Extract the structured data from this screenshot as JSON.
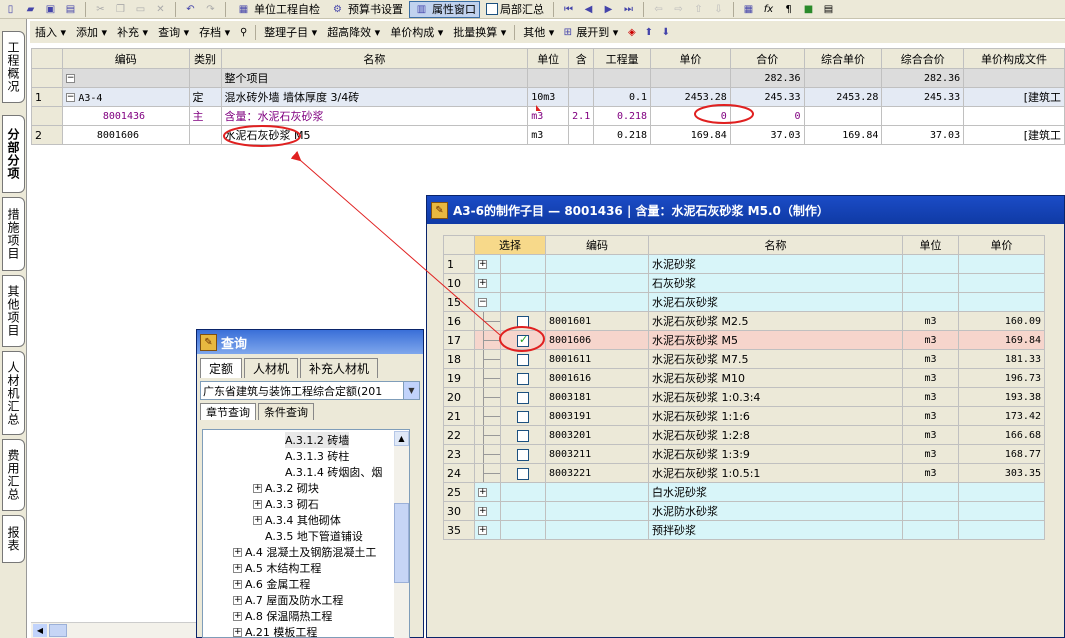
{
  "toolbar1": {
    "self_check": "单位工程自检",
    "budget_settings": "预算书设置",
    "property_window": "属性窗口",
    "partial_summary": "局部汇总"
  },
  "toolbar2": {
    "items": [
      "插入 ▾",
      "添加 ▾",
      "补充 ▾",
      "查询 ▾",
      "存档 ▾",
      "整理子目 ▾",
      "超高降效 ▾",
      "单价构成 ▾",
      "批量换算 ▾",
      "其他 ▾",
      "展开到 ▾"
    ]
  },
  "left_tabs": [
    "工程概况",
    "分部分项",
    "措施项目",
    "其他项目",
    "人材机汇总",
    "费用汇总",
    "报表"
  ],
  "main_table": {
    "headers": [
      "编码",
      "类别",
      "名称",
      "单位",
      "含",
      "工程量",
      "单价",
      "合价",
      "综合单价",
      "综合合价",
      "单价构成文件"
    ],
    "rows": [
      {
        "no": "",
        "code": "",
        "type": "",
        "name": "整个项目",
        "unit": "",
        "han": "",
        "qty": "",
        "price": "",
        "total": "282.36",
        "comp_price": "",
        "comp_total": "282.36",
        "file": ""
      },
      {
        "no": "1",
        "code": "A3-4",
        "type": "定",
        "name": "混水砖外墙 墙体厚度 3/4砖",
        "unit": "10m3",
        "han": "",
        "qty": "0.1",
        "price": "2453.28",
        "total": "245.33",
        "comp_price": "2453.28",
        "comp_total": "245.33",
        "file": "[建筑工"
      },
      {
        "no": "",
        "code": "8001436",
        "type": "主",
        "name": "含量：水泥石灰砂浆",
        "unit": "m3",
        "han": "2.1",
        "qty": "0.218",
        "price": "0",
        "total": "0",
        "comp_price": "",
        "comp_total": "",
        "file": ""
      },
      {
        "no": "2",
        "code": "8001606",
        "type": "",
        "name": "水泥石灰砂浆 M5",
        "unit": "m3",
        "han": "",
        "qty": "0.218",
        "price": "169.84",
        "total": "37.03",
        "comp_price": "169.84",
        "comp_total": "37.03",
        "file": "[建筑工"
      }
    ]
  },
  "sub_window": {
    "title": "A3-6的制作子目 — 8001436 | 含量：水泥石灰砂浆 M5.0（制作）",
    "headers": [
      "选择",
      "编码",
      "名称",
      "单位",
      "单价"
    ],
    "rows": [
      {
        "no": "1",
        "kind": "group",
        "expand": "+",
        "code": "",
        "name": "水泥砂浆",
        "unit": "",
        "price": ""
      },
      {
        "no": "10",
        "kind": "group",
        "expand": "+",
        "code": "",
        "name": "石灰砂浆",
        "unit": "",
        "price": ""
      },
      {
        "no": "15",
        "kind": "group",
        "expand": "−",
        "code": "",
        "name": "水泥石灰砂浆",
        "unit": "",
        "price": ""
      },
      {
        "no": "16",
        "kind": "item",
        "checked": false,
        "code": "8001601",
        "name": "水泥石灰砂浆 M2.5",
        "unit": "m3",
        "price": "160.09"
      },
      {
        "no": "17",
        "kind": "item",
        "checked": true,
        "code": "8001606",
        "name": "水泥石灰砂浆 M5",
        "unit": "m3",
        "price": "169.84"
      },
      {
        "no": "18",
        "kind": "item",
        "checked": false,
        "code": "8001611",
        "name": "水泥石灰砂浆 M7.5",
        "unit": "m3",
        "price": "181.33"
      },
      {
        "no": "19",
        "kind": "item",
        "checked": false,
        "code": "8001616",
        "name": "水泥石灰砂浆 M10",
        "unit": "m3",
        "price": "196.73"
      },
      {
        "no": "20",
        "kind": "item",
        "checked": false,
        "code": "8003181",
        "name": "水泥石灰砂浆 1:0.3:4",
        "unit": "m3",
        "price": "193.38"
      },
      {
        "no": "21",
        "kind": "item",
        "checked": false,
        "code": "8003191",
        "name": "水泥石灰砂浆 1:1:6",
        "unit": "m3",
        "price": "173.42"
      },
      {
        "no": "22",
        "kind": "item",
        "checked": false,
        "code": "8003201",
        "name": "水泥石灰砂浆 1:2:8",
        "unit": "m3",
        "price": "166.68"
      },
      {
        "no": "23",
        "kind": "item",
        "checked": false,
        "code": "8003211",
        "name": "水泥石灰砂浆 1:3:9",
        "unit": "m3",
        "price": "168.77"
      },
      {
        "no": "24",
        "kind": "item",
        "checked": false,
        "code": "8003221",
        "name": "水泥石灰砂浆 1:0.5:1",
        "unit": "m3",
        "price": "303.35"
      },
      {
        "no": "25",
        "kind": "group",
        "expand": "+",
        "code": "",
        "name": "白水泥砂浆",
        "unit": "",
        "price": ""
      },
      {
        "no": "30",
        "kind": "group",
        "expand": "+",
        "code": "",
        "name": "水泥防水砂浆",
        "unit": "",
        "price": ""
      },
      {
        "no": "35",
        "kind": "group",
        "expand": "+",
        "code": "",
        "name": "预拌砂浆",
        "unit": "",
        "price": ""
      }
    ]
  },
  "query_window": {
    "title": "查询",
    "tabs": [
      "定额",
      "人材机",
      "补充人材机"
    ],
    "library": "广东省建筑与装饰工程综合定额(201",
    "subtabs": [
      "章节查询",
      "条件查询"
    ],
    "tree": [
      {
        "label": "A.3.1.2 砖墙",
        "expand": ""
      },
      {
        "label": "A.3.1.3 砖柱",
        "expand": ""
      },
      {
        "label": "A.3.1.4 砖烟囱、烟",
        "expand": ""
      },
      {
        "label": "A.3.2 砌块",
        "expand": "+"
      },
      {
        "label": "A.3.3 砌石",
        "expand": "+"
      },
      {
        "label": "A.3.4 其他砌体",
        "expand": "+"
      },
      {
        "label": "A.3.5 地下管道铺设",
        "expand": ""
      },
      {
        "label": "A.4 混凝土及钢筋混凝土工",
        "expand": "+"
      },
      {
        "label": "A.5 木结构工程",
        "expand": "+"
      },
      {
        "label": "A.6 金属工程",
        "expand": "+"
      },
      {
        "label": "A.7 屋面及防水工程",
        "expand": "+"
      },
      {
        "label": "A.8 保温隔热工程",
        "expand": "+"
      },
      {
        "label": "A.21 模板工程",
        "expand": "+"
      }
    ]
  },
  "colors": {
    "annotation": "#e02020",
    "title_bar": "#0f3aa5",
    "cyan_row": "#d8f5f9",
    "selected_row": "#f6d5cc"
  }
}
